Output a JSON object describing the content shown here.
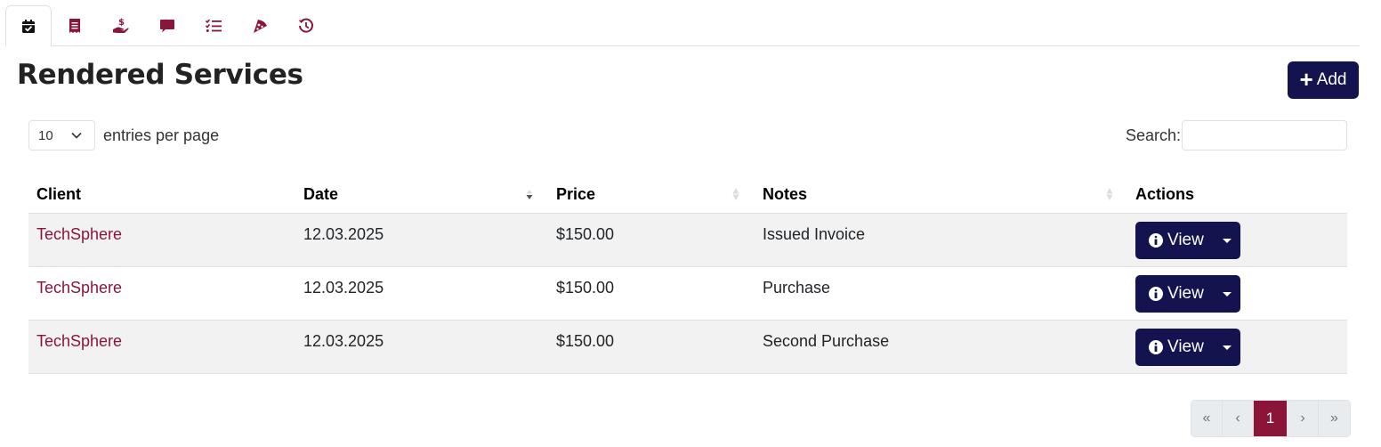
{
  "tabs": [
    {
      "name": "calendar-check",
      "active": true
    },
    {
      "name": "receipt",
      "active": false
    },
    {
      "name": "hand-dollar",
      "active": false
    },
    {
      "name": "comment",
      "active": false
    },
    {
      "name": "list-check",
      "active": false
    },
    {
      "name": "pizza-slice",
      "active": false
    },
    {
      "name": "history",
      "active": false
    }
  ],
  "header": {
    "title": "Rendered Services",
    "add_label": "Add"
  },
  "controls": {
    "entries_value": "10",
    "entries_label": "entries per page",
    "search_label": "Search:",
    "search_value": ""
  },
  "table": {
    "columns": [
      "Client",
      "Date",
      "Price",
      "Notes",
      "Actions"
    ],
    "rows": [
      {
        "client": "TechSphere",
        "date": "12.03.2025",
        "price": "$150.00",
        "notes": "Issued Invoice",
        "action": "View"
      },
      {
        "client": "TechSphere",
        "date": "12.03.2025",
        "price": "$150.00",
        "notes": "Purchase",
        "action": "View"
      },
      {
        "client": "TechSphere",
        "date": "12.03.2025",
        "price": "$150.00",
        "notes": "Second Purchase",
        "action": "View"
      }
    ]
  },
  "pagination": {
    "first": "«",
    "prev": "‹",
    "current": "1",
    "next": "›",
    "last": "»"
  },
  "colors": {
    "primary": "#13134f",
    "accent": "#8b1538",
    "stripe": "#f2f2f2"
  }
}
